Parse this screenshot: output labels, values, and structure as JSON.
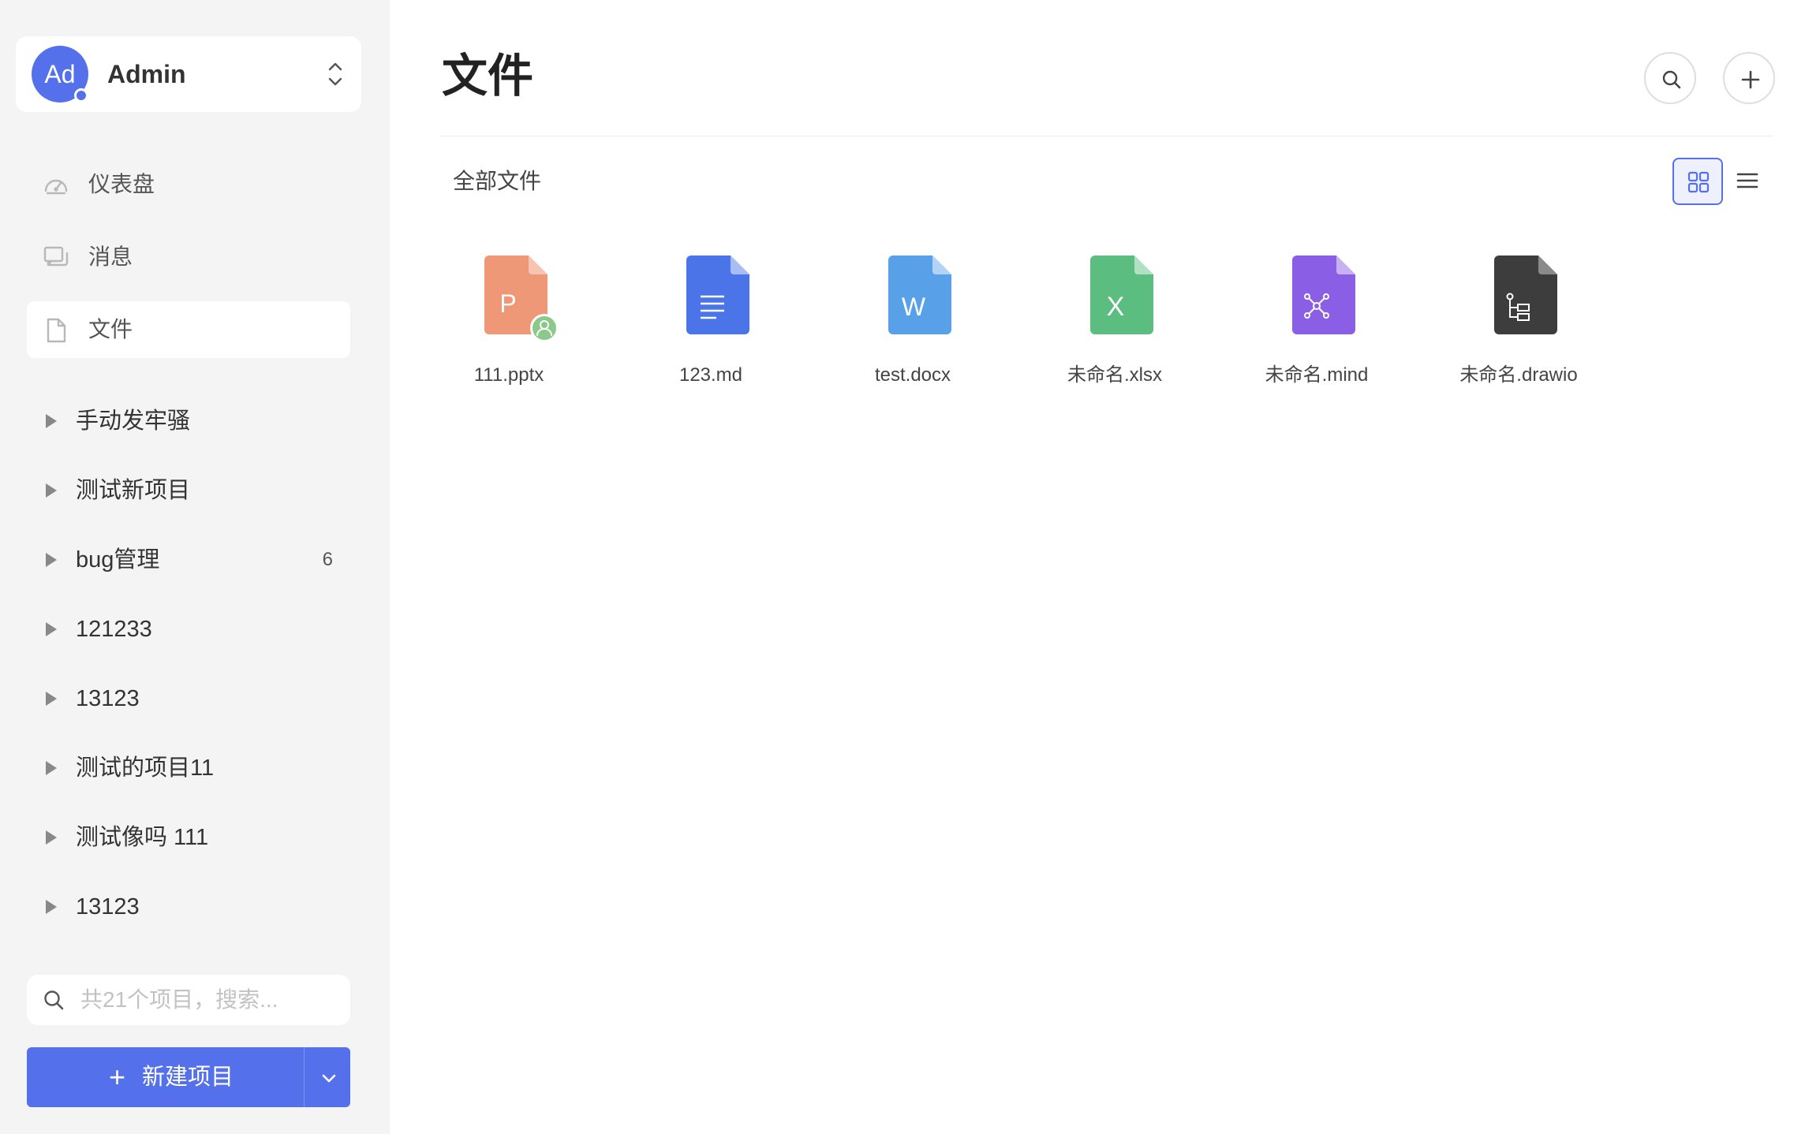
{
  "user": {
    "avatar_initials": "Ad",
    "name": "Admin"
  },
  "nav": {
    "items": [
      {
        "label": "仪表盘",
        "icon": "dashboard-icon"
      },
      {
        "label": "消息",
        "icon": "message-icon"
      },
      {
        "label": "文件",
        "icon": "file-icon",
        "active": true
      }
    ]
  },
  "projects": [
    {
      "label": "手动发牢骚"
    },
    {
      "label": "测试新项目"
    },
    {
      "label": "bug管理",
      "count": "6"
    },
    {
      "label": "121233"
    },
    {
      "label": "13123"
    },
    {
      "label": "测试的项目11"
    },
    {
      "label": "测试像吗 111"
    },
    {
      "label": "13123"
    }
  ],
  "project_search": {
    "placeholder": "共21个项目，搜索..."
  },
  "new_project": {
    "label": "新建项目"
  },
  "main": {
    "title": "文件",
    "breadcrumb": "全部文件",
    "view_mode": "grid"
  },
  "files": [
    {
      "name": "111.pptx",
      "type": "pptx",
      "letter": "P",
      "color": "#ef9878",
      "shared": true
    },
    {
      "name": "123.md",
      "type": "md",
      "letter": "",
      "color": "#4b74e8"
    },
    {
      "name": "test.docx",
      "type": "docx",
      "letter": "W",
      "color": "#58a0e8"
    },
    {
      "name": "未命名.xlsx",
      "type": "xlsx",
      "letter": "X",
      "color": "#5bbd7f"
    },
    {
      "name": "未命名.mind",
      "type": "mind",
      "letter": "",
      "color": "#8b5ee6"
    },
    {
      "name": "未命名.drawio",
      "type": "drawio",
      "letter": "",
      "color": "#3d3d3d"
    }
  ],
  "colors": {
    "sidebar_bg": "#f4f4f5",
    "accent": "#5470ea"
  }
}
